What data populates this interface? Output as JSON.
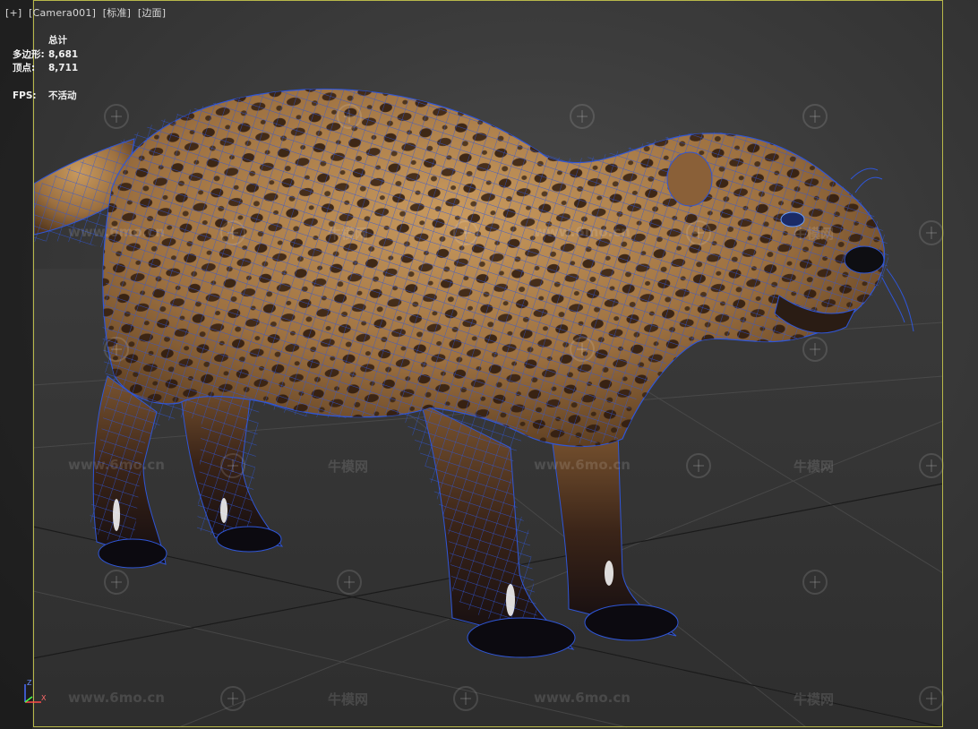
{
  "viewport": {
    "labels": [
      "[+]",
      "[Camera001]",
      "[标准]",
      "[边面]"
    ]
  },
  "stats": {
    "total_label": "总计",
    "polygons_label": "多边形:",
    "polygons_value": "8,681",
    "vertices_label": "顶点:",
    "vertices_value": "8,711",
    "fps_label": "FPS:",
    "fps_value": "不活动"
  },
  "watermark": {
    "url": "www.6mo.cn",
    "brand": "牛模网"
  },
  "gizmo": {
    "z_label": "Z",
    "x_label": "X"
  },
  "colors": {
    "frame": "#b8b84a",
    "wire": "#2f56d8",
    "fur": "#b28550"
  }
}
